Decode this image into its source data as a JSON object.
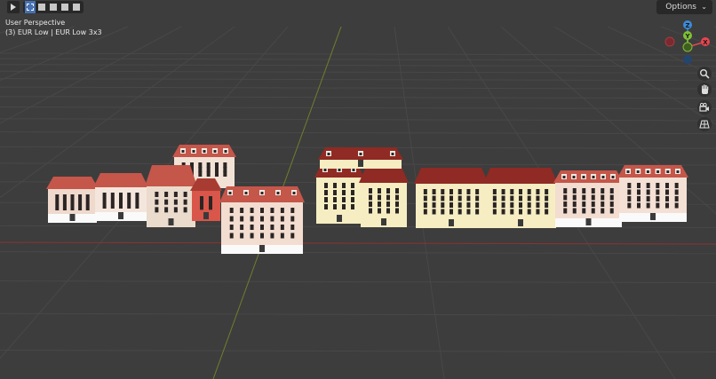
{
  "header": {
    "select_tool_icon": "select-cursor-icon",
    "mode_icons": [
      "select-box-icon",
      "select-extend-icon",
      "select-subtract-icon",
      "select-invert-icon",
      "select-intersect-icon"
    ],
    "options_label": "Options"
  },
  "viewport_overlay": {
    "view_name": "User Perspective",
    "object_info": "(3) EUR Low | EUR Low 3x3"
  },
  "gizmo": {
    "z_label": "Z",
    "y_label": "Y",
    "x_label": "X",
    "colors": {
      "x": "#e8454f",
      "y": "#7fc134",
      "z": "#3c8bdb"
    }
  },
  "nav_buttons": [
    "zoom-icon",
    "hand-pan-icon",
    "camera-icon",
    "grid-ortho-icon"
  ],
  "colors": {
    "background": "#3d3d3d",
    "grid": "#4a4a4a",
    "x_axis": "#9b3a3a",
    "y_axis": "#7c8c2c",
    "roof": "#8f2a24",
    "roof_red": "#c5564a"
  }
}
